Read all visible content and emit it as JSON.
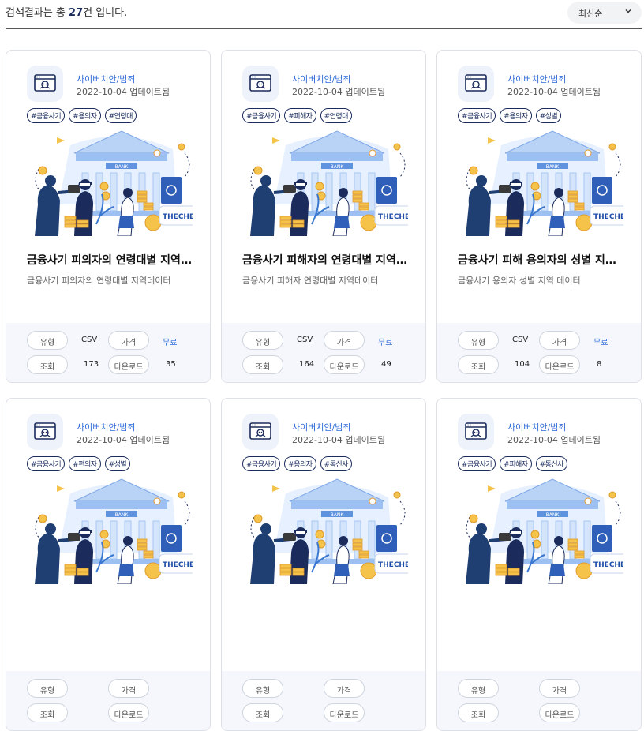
{
  "header": {
    "result_prefix": "검색결과는 총 ",
    "result_count": "27",
    "result_suffix": "건 입니다.",
    "sort_label": "최신순"
  },
  "labels": {
    "type": "유형",
    "price": "가격",
    "views": "조회",
    "downloads": "다운로드"
  },
  "illustration": {
    "bank_text": "BANK",
    "logo_text": "THECHEAT"
  },
  "cards": [
    {
      "category": "사이버치안/범죄",
      "date": "2022-10-04 업데이트됨",
      "tags": [
        "#금융사기",
        "#용의자",
        "#연령대"
      ],
      "title": "금융사기 피의자의 연령대별 지역…",
      "desc": "금융사기 피의자의 연령대별 지역데이터",
      "type": "CSV",
      "price": "무료",
      "views": "173",
      "downloads": "35"
    },
    {
      "category": "사이버치안/범죄",
      "date": "2022-10-04 업데이트됨",
      "tags": [
        "#금융사기",
        "#피해자",
        "#연령대"
      ],
      "title": "금융사기 피해자의 연령대별 지역…",
      "desc": "금융사기 피해자 연령대별 지역데이터",
      "type": "CSV",
      "price": "무료",
      "views": "164",
      "downloads": "49"
    },
    {
      "category": "사이버치안/범죄",
      "date": "2022-10-04 업데이트됨",
      "tags": [
        "#금융사기",
        "#용의자",
        "#성별"
      ],
      "title": "금융사기 피해 용의자의 성별 지…",
      "desc": "금융사기 용의자 성별 지역 데이터",
      "type": "CSV",
      "price": "무료",
      "views": "104",
      "downloads": "8"
    },
    {
      "category": "사이버치안/범죄",
      "date": "2022-10-04 업데이트됨",
      "tags": [
        "#금융사기",
        "#편의자",
        "#성별"
      ],
      "title": "",
      "desc": "",
      "type": "",
      "price": "",
      "views": "",
      "downloads": ""
    },
    {
      "category": "사이버치안/범죄",
      "date": "2022-10-04 업데이트됨",
      "tags": [
        "#금융사기",
        "#용의자",
        "#통신사"
      ],
      "title": "",
      "desc": "",
      "type": "",
      "price": "",
      "views": "",
      "downloads": ""
    },
    {
      "category": "사이버치안/범죄",
      "date": "2022-10-04 업데이트됨",
      "tags": [
        "#금융사기",
        "#피해자",
        "#통신사"
      ],
      "title": "",
      "desc": "",
      "type": "",
      "price": "",
      "views": "",
      "downloads": ""
    }
  ]
}
